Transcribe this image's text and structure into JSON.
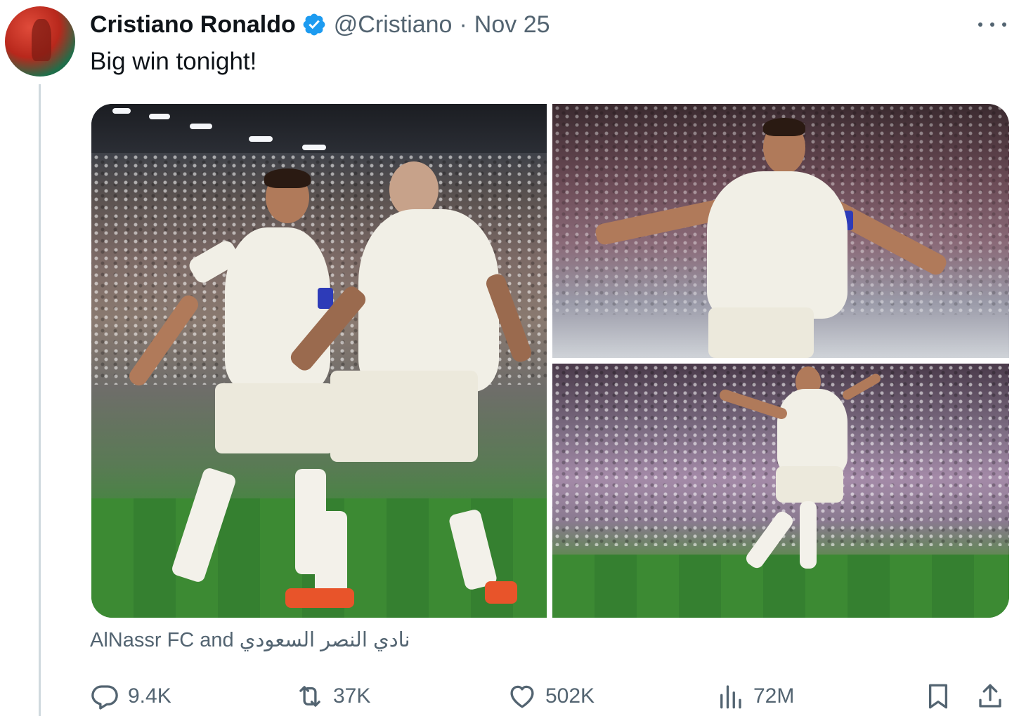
{
  "tweet": {
    "author": {
      "name": "Cristiano Ronaldo",
      "handle": "@Cristiano",
      "verified": true,
      "verified_color": "#1d9bf0"
    },
    "separator": "·",
    "date": "Nov 25",
    "text": "Big win tonight!",
    "caption": {
      "tag_1": "AlNassr FC",
      "conjunction": "and",
      "tag_2": "نادي النصر السعودي"
    },
    "media": {
      "count": 3,
      "photos": [
        {
          "name": "photo-celebration-duo"
        },
        {
          "name": "photo-celebration-arms-wide"
        },
        {
          "name": "photo-celebration-running"
        }
      ]
    },
    "stats": {
      "replies": "9.4K",
      "reposts": "37K",
      "likes": "502K",
      "views": "72M"
    }
  },
  "icons": {
    "more": "more-options-icon",
    "reply": "reply-icon",
    "repost": "repost-icon",
    "like": "heart-icon",
    "views": "views-icon",
    "bookmark": "bookmark-icon",
    "share": "share-icon"
  },
  "colors": {
    "text_primary": "#0f1419",
    "text_secondary": "#536471",
    "thread_line": "#cfd9de"
  }
}
